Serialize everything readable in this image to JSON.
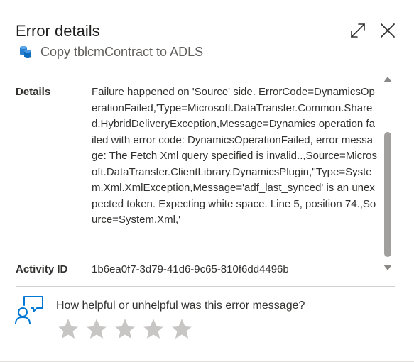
{
  "header": {
    "title": "Error details",
    "subtitle": "Copy tblcmContract to ADLS",
    "icons": {
      "expand": "expand-icon",
      "close": "close-icon",
      "pipeline": "database-icon"
    }
  },
  "details": {
    "label": "Details",
    "text": "Failure happened on 'Source' side. ErrorCode=DynamicsOperationFailed,'Type=Microsoft.DataTransfer.Common.Shared.HybridDeliveryException,Message=Dynamics operation failed with error code: DynamicsOperationFailed, error message: The Fetch Xml query specified is invalid..,Source=Microsoft.DataTransfer.ClientLibrary.DynamicsPlugin,''Type=System.Xml.XmlException,Message='adf_last_synced' is an unexpected token. Expecting white space. Line 5, position 74.,Source=System.Xml,'"
  },
  "activity": {
    "label": "Activity ID",
    "value": "1b6ea0f7-3d79-41d6-9c65-810f6dd4496b"
  },
  "feedback": {
    "question": "How helpful or unhelpful was this error message?",
    "rating": {
      "max": 5,
      "selected": 0
    }
  },
  "colors": {
    "accent": "#0078d4",
    "star_inactive": "#c8c6c4",
    "text": "#323130",
    "subtle_text": "#605e5c"
  }
}
